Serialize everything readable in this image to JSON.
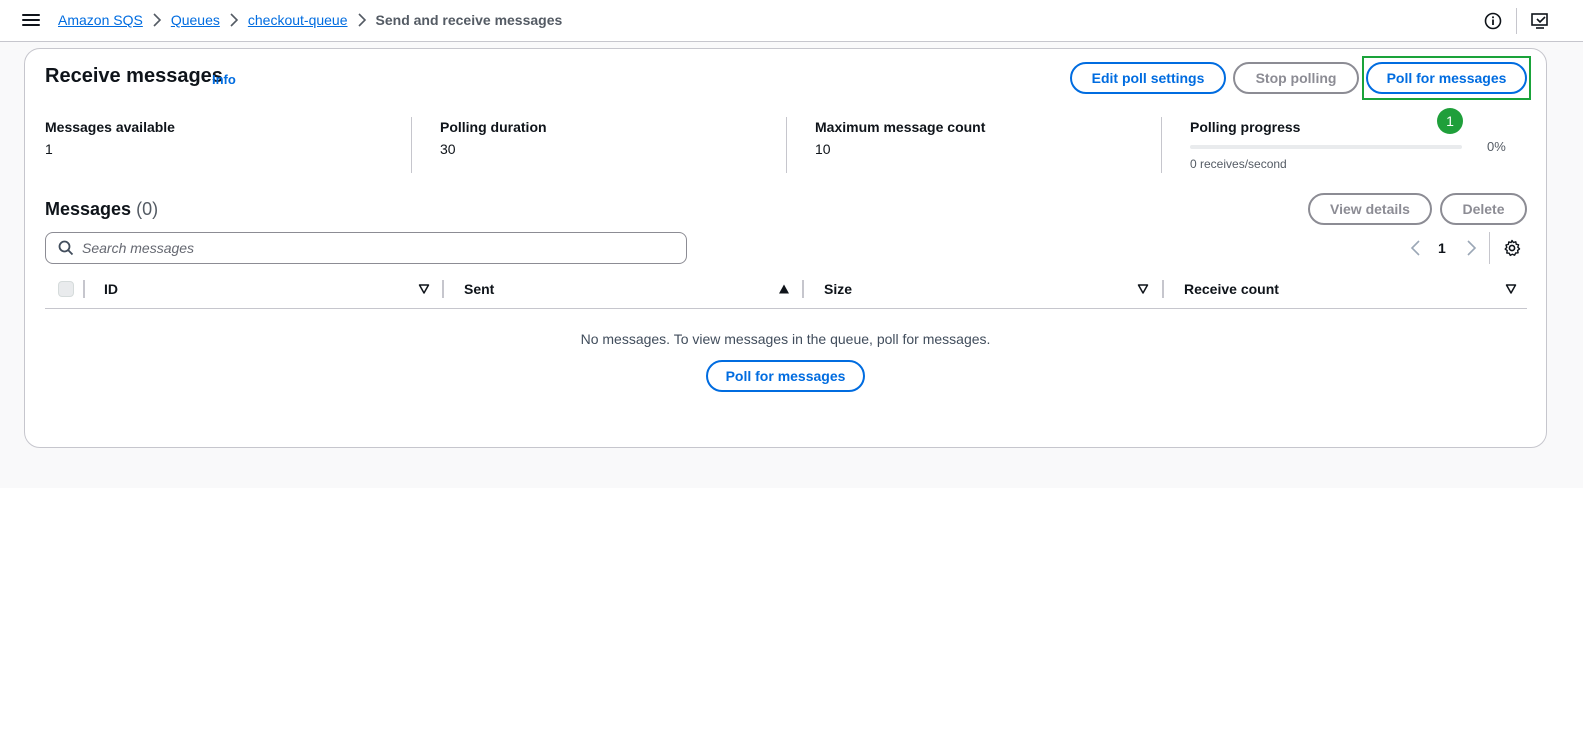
{
  "breadcrumb": {
    "items": [
      "Amazon SQS",
      "Queues",
      "checkout-queue"
    ],
    "current": "Send and receive messages"
  },
  "header": {
    "title": "Receive messages",
    "info": "Info",
    "buttons": {
      "edit_poll": "Edit poll settings",
      "stop_polling": "Stop polling",
      "poll": "Poll for messages"
    },
    "highlight_badge": "1"
  },
  "stats": {
    "messages_available": {
      "label": "Messages available",
      "value": "1"
    },
    "polling_duration": {
      "label": "Polling duration",
      "value": "30"
    },
    "max_message_count": {
      "label": "Maximum message count",
      "value": "10"
    },
    "polling_progress": {
      "label": "Polling progress",
      "percent": "0%",
      "fraction": 0,
      "rate": "0 receives/second"
    }
  },
  "messages": {
    "title": "Messages",
    "count": "(0)",
    "buttons": {
      "view_details": "View details",
      "delete": "Delete"
    },
    "search_placeholder": "Search messages",
    "page": "1",
    "columns": [
      "ID",
      "Sent",
      "Size",
      "Receive count"
    ],
    "empty_text": "No messages. To view messages in the queue, poll for messages.",
    "empty_button": "Poll for messages"
  },
  "colors": {
    "link": "#006ce0",
    "disabled": "#8c8c94",
    "highlight": "#1aa33a"
  },
  "icons": [
    "menu-icon",
    "chevron-right-icon",
    "info-circle-icon",
    "feedback-icon",
    "search-icon",
    "chevron-left-icon",
    "gear-icon",
    "sort-down-icon",
    "sort-up-icon"
  ]
}
